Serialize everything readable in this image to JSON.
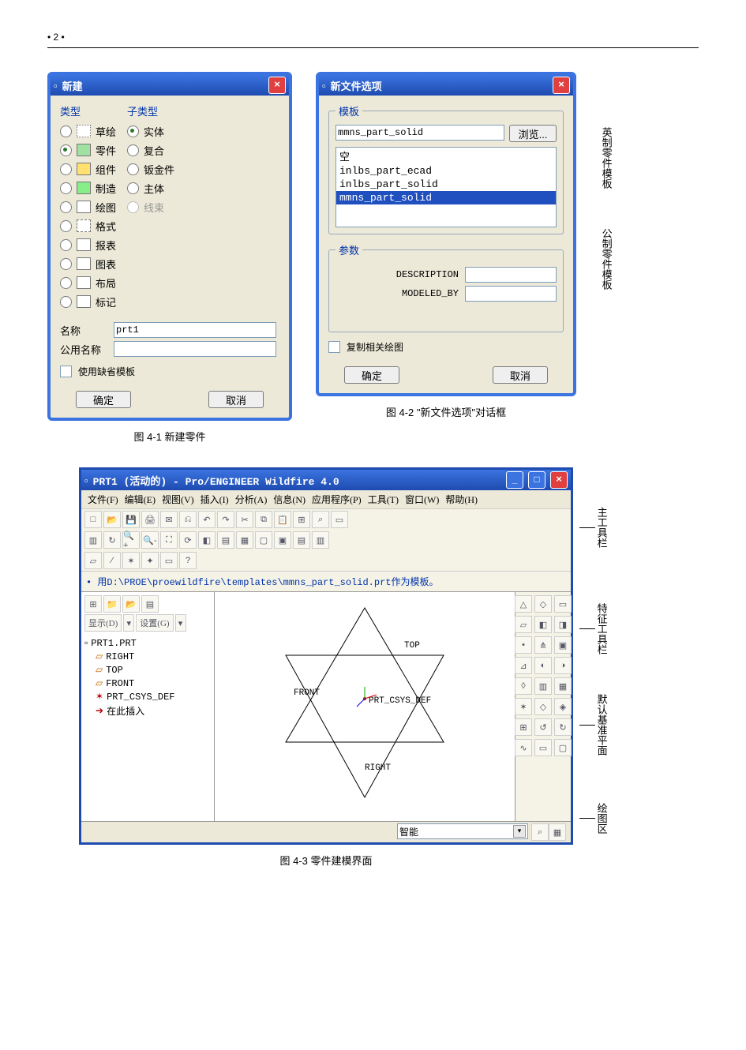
{
  "page": {
    "num": "• 2 •"
  },
  "dlg1": {
    "title": "新建",
    "typeLabel": "类型",
    "subtypeLabel": "子类型",
    "types": [
      "草绘",
      "零件",
      "组件",
      "制造",
      "绘图",
      "格式",
      "报表",
      "图表",
      "布局",
      "标记"
    ],
    "selectedType": 1,
    "subtypes": [
      "实体",
      "复合",
      "钣金件",
      "主体",
      "线束"
    ],
    "selectedSubtype": 0,
    "disabledSubtype": 4,
    "nameLabel": "名称",
    "nameValue": "prt1",
    "commonLabel": "公用名称",
    "commonValue": "",
    "useDefault": "使用缺省模板",
    "ok": "确定",
    "cancel": "取消"
  },
  "dlg2": {
    "title": "新文件选项",
    "templateGroup": "模板",
    "templateValue": "mmns_part_solid",
    "browse": "浏览...",
    "list": [
      "空",
      "inlbs_part_ecad",
      "inlbs_part_solid",
      "mmns_part_solid"
    ],
    "listSel": 3,
    "paramGroup": "参数",
    "params": [
      "DESCRIPTION",
      "MODELED_BY"
    ],
    "copyDwg": "复制相关绘图",
    "ok": "确定",
    "cancel": "取消"
  },
  "notes": {
    "n1": "英制零件模板",
    "n2": "公制零件模板"
  },
  "cap1": "图 4-1  新建零件",
  "cap2": "图 4-2 \"新文件选项\"对话框",
  "fig3": {
    "title": "PRT1 (活动的) - Pro/ENGINEER Wildfire 4.0",
    "menu": [
      "文件(F)",
      "编辑(E)",
      "视图(V)",
      "插入(I)",
      "分析(A)",
      "信息(N)",
      "应用程序(P)",
      "工具(T)",
      "窗口(W)",
      "帮助(H)"
    ],
    "msgPrefix": "• 用",
    "msgPath": "D:\\PROE\\proewildfire\\templates\\mmns_part_solid.prt",
    "msgSuffix": "作为模板。",
    "treeTop": "PRT1.PRT",
    "tree": [
      "RIGHT",
      "TOP",
      "FRONT",
      "PRT_CSYS_DEF",
      "在此插入"
    ],
    "treetoolbar": {
      "btn1": "显示(D)",
      "btn2": "设置(G)"
    },
    "planes": {
      "front": "FRONT",
      "top": "TOP",
      "right": "RIGHT",
      "csys": "PRT_CSYS_DEF"
    },
    "statusCombo": "智能"
  },
  "notes3": {
    "a": "主工具栏",
    "b": "特征工具栏",
    "c": "默认基准平面",
    "d": "绘图区"
  },
  "cap3": "图 4-3  零件建模界面"
}
